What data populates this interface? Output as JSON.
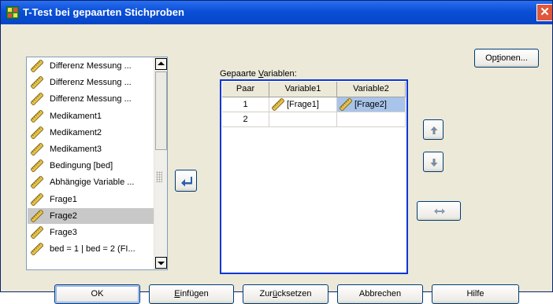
{
  "window": {
    "title": "T-Test bei gepaarten Stichproben",
    "close_glyph": "✕"
  },
  "variables": [
    {
      "label": "Differenz Messung ...",
      "selected": false
    },
    {
      "label": "Differenz Messung ...",
      "selected": false
    },
    {
      "label": "Differenz Messung ...",
      "selected": false
    },
    {
      "label": "Medikament1",
      "selected": false
    },
    {
      "label": "Medikament2",
      "selected": false
    },
    {
      "label": "Medikament3",
      "selected": false
    },
    {
      "label": "Bedingung [bed]",
      "selected": false
    },
    {
      "label": "Abhängige Variable ...",
      "selected": false
    },
    {
      "label": "Frage1",
      "selected": false
    },
    {
      "label": "Frage2",
      "selected": true
    },
    {
      "label": "Frage3",
      "selected": false
    },
    {
      "label": "bed = 1 | bed = 2 (FI...",
      "selected": false
    }
  ],
  "paired": {
    "label_prefix": "Gepaarte ",
    "label_accel": "V",
    "label_suffix": "ariablen:",
    "headers": [
      "Paar",
      "Variable1",
      "Variable2"
    ],
    "rows": [
      {
        "paar": "1",
        "var1": "[Frage1]",
        "var2": "[Frage2]"
      },
      {
        "paar": "2",
        "var1": "",
        "var2": ""
      }
    ]
  },
  "buttons": {
    "options_pre": "Op",
    "options_accel": "t",
    "options_post": "ionen...",
    "ok": "OK",
    "paste_accel": "E",
    "paste_post": "infügen",
    "reset_pre": "Zur",
    "reset_accel": "ü",
    "reset_post": "cksetzen",
    "cancel": "Abbrechen",
    "help": "Hilfe"
  },
  "icons": {
    "variable": "scale-ruler-icon",
    "move": "move-right-arrow-icon",
    "up": "arrow-up-icon",
    "down": "arrow-down-icon",
    "swap": "swap-icon"
  },
  "colors": {
    "title_bar": "#0a4fd6",
    "grid_border": "#0a37d6",
    "selected_cell": "#a9c4eb",
    "selected_item": "#c8c8c8"
  }
}
